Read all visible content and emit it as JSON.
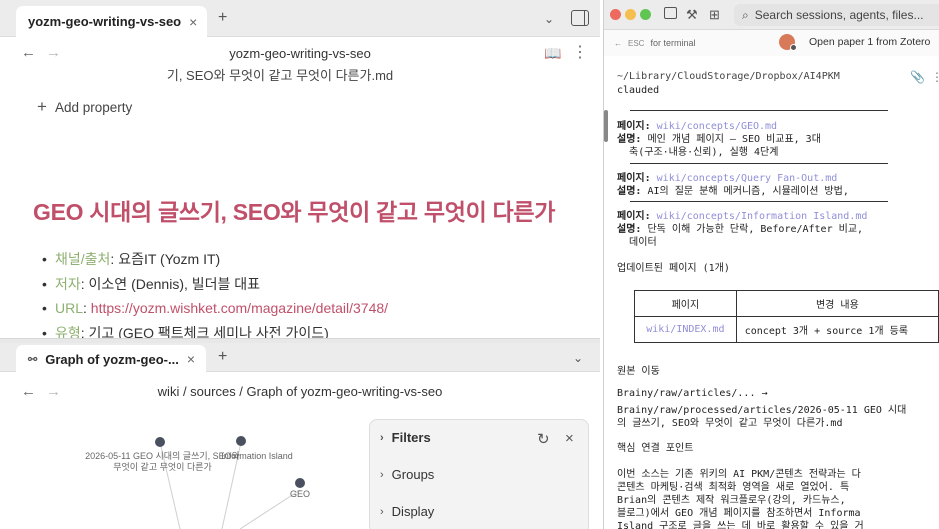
{
  "left": {
    "top_tab": {
      "title": "yozm-geo-writing-vs-seo",
      "close": "×",
      "new": "+"
    },
    "nav": {
      "back": "←",
      "forward": "→",
      "title": "yozm-geo-writing-vs-seo"
    },
    "cut_filename": "기, SEO와 무엇이 같고 무엇이 다른가.md",
    "add_property": {
      "icon": "+",
      "label": "Add property"
    },
    "doc": {
      "h1": "GEO 시대의 글쓰기, SEO와 무엇이 같고 무엇이 다른가",
      "bullets": [
        {
          "key": "채널/출처",
          "sep": ": ",
          "val": "요즘IT (Yozm IT)"
        },
        {
          "key": "저자",
          "sep": ": ",
          "val": "이소연 (Dennis), 빌더블 대표"
        },
        {
          "key": "URL",
          "sep": ": ",
          "val": "https://yozm.wishket.com/magazine/detail/3748/"
        },
        {
          "key": "유형",
          "sep": ": ",
          "val": "기고 (GEO 팩트체크 세미나 사전 가이드)"
        }
      ]
    },
    "graph_tab": {
      "title": "Graph of yozm-geo-...",
      "close": "×",
      "new": "+"
    },
    "graph_nav": {
      "back": "←",
      "forward": "→",
      "title": "wiki / sources / Graph of yozm-geo-writing-vs-seo"
    },
    "graph_labels": {
      "node1": "2026-05-11 GEO 시대의 글쓰기, SEO와\n무엇이 같고 무엇이 다른가",
      "node2": "Information Island",
      "node3": "GEO"
    },
    "filters": {
      "items": [
        {
          "chev": "›",
          "label": "Filters"
        },
        {
          "chev": "›",
          "label": "Groups"
        },
        {
          "chev": "›",
          "label": "Display"
        }
      ],
      "refresh": "↻",
      "close": "×"
    }
  },
  "right": {
    "search_placeholder": "Search sessions, agents, files...",
    "esc_key": "ESC",
    "esc_label": "for terminal",
    "open_paper": "Open paper 1 from Zotero",
    "cwd": "~/Library/CloudStorage/Dropbox/AI4PKM",
    "prompt_cmd": "clauded",
    "entries": [
      {
        "k1": "페이지: ",
        "v1": "wiki/concepts/GEO.md",
        "k2": "설명: ",
        "v2": "메인 개념 페이지 — SEO 비교표, 3대",
        "v3": "  축(구조·내용·신뢰), 실행 4단계"
      },
      {
        "k1": "페이지: ",
        "v1": "wiki/concepts/Query Fan-Out.md",
        "k2": "설명: ",
        "v2": "AI의 질문 분해 메커니즘, 시뮬레이션 방법,",
        "v3": ""
      },
      {
        "k1": "페이지: ",
        "v1": "wiki/concepts/Information Island.md",
        "k2": "설명: ",
        "v2": "단독 이해 가능한 단락, Before/After 비교,",
        "v3": "  데이터"
      }
    ],
    "updated_heading": "업데이트된 페이지 (1개)",
    "table": {
      "headers": [
        "페이지",
        "변경 내용"
      ],
      "row": [
        "wiki/INDEX.md",
        "concept 3개 + source 1개 등록"
      ]
    },
    "move_heading": "원본 이동",
    "move_lines": [
      "Brainy/raw/articles/... →",
      "Brainy/raw/processed/articles/2026-05-11 GEO 시대",
      "의 글쓰기, SEO와 무엇이 같고 무엇이 다른가.md"
    ],
    "core_heading": "핵심 연결 포인트",
    "core_lines": [
      "이번 소스는 기존 위키의 AI PKM/콘텐츠 전략과는 다",
      "콘텐츠 마케팅·검색 최적화 영역을 새로 열었어. 특",
      "Brian의 콘텐츠 제작 워크플로우(강의, 카드뉴스,",
      "블로그)에서 GEO 개념 페이지를 참조하면서 Informa",
      "Island 구조로 글을 쓰는 데 바로 활용할 수 있을 거"
    ]
  }
}
